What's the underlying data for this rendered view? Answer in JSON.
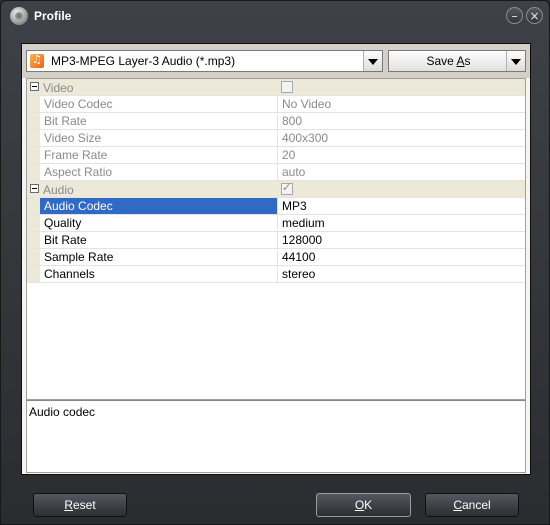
{
  "window": {
    "title": "Profile"
  },
  "profile_select": {
    "value": "MP3-MPEG Layer-3 Audio (*.mp3)",
    "icon": "music-note-icon"
  },
  "save_as": {
    "label_pre": "Save ",
    "label_underline": "A",
    "label_post": "s"
  },
  "categories": {
    "video": {
      "label": "Video",
      "checked": false,
      "rows": [
        {
          "name": "Video Codec",
          "value": "No Video"
        },
        {
          "name": "Bit Rate",
          "value": "800"
        },
        {
          "name": "Video Size",
          "value": "400x300"
        },
        {
          "name": "Frame Rate",
          "value": "20"
        },
        {
          "name": "Aspect Ratio",
          "value": "auto"
        }
      ]
    },
    "audio": {
      "label": "Audio",
      "checked": true,
      "rows": [
        {
          "name": "Audio Codec",
          "value": "MP3",
          "selected": true
        },
        {
          "name": "Quality",
          "value": "medium"
        },
        {
          "name": "Bit Rate",
          "value": "128000"
        },
        {
          "name": "Sample Rate",
          "value": "44100"
        },
        {
          "name": "Channels",
          "value": "stereo"
        }
      ]
    }
  },
  "description": "Audio codec",
  "buttons": {
    "reset": {
      "underline": "R",
      "rest": "eset"
    },
    "ok": {
      "underline": "O",
      "rest": "K"
    },
    "cancel": {
      "underline": "C",
      "rest": "ancel"
    }
  },
  "colors": {
    "selection": "#316ac5",
    "category_bg": "#ece9d8",
    "frame": "#2b2d31"
  }
}
